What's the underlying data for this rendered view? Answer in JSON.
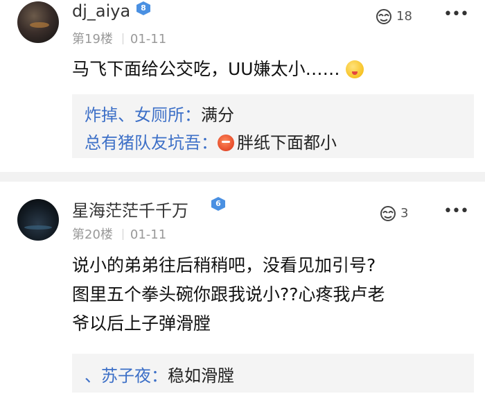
{
  "posts": [
    {
      "username": "dj_aiya",
      "level": "8",
      "floor": "第19楼",
      "date": "01-11",
      "likes": "18",
      "content": "马飞下面给公交吃，UU嫌太小……",
      "replies": [
        {
          "author": "炸掉、女厕所：",
          "text": "满分"
        },
        {
          "author": "总有猪队友坑吾：",
          "text": "胖纸下面都小"
        }
      ]
    },
    {
      "username": "星海茫茫千千万",
      "level": "6",
      "floor": "第20楼",
      "date": "01-11",
      "likes": "3",
      "content_lines": [
        "说小的弟弟往后稍稍吧，没看见加引号?",
        "图里五个拳头碗你跟我说小??心疼我卢老",
        "爷以后上子弹滑膛"
      ],
      "replies": [
        {
          "author": "、苏子夜：",
          "text": "稳如滑膛"
        }
      ]
    }
  ],
  "icons": {
    "like": "like-icon",
    "more": "more-icon",
    "level": "level-badge-icon",
    "emoji": "emoji-icon"
  },
  "colors": {
    "reply_author": "#3c6fc7",
    "level_badge": "#4a90e2",
    "meta_text": "#999999",
    "reply_bg": "#f4f4f4"
  }
}
